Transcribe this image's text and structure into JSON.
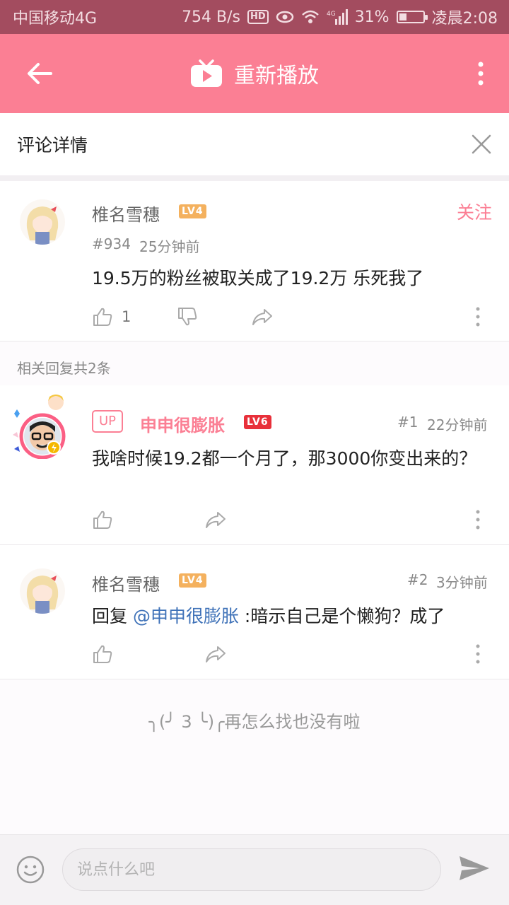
{
  "status_bar": {
    "carrier": "中国移动4G",
    "network_speed": "754 B/s",
    "hd_badge": "HD",
    "battery_percent": "31%",
    "battery_level": 0.31,
    "time": "凌晨2:08"
  },
  "toolbar": {
    "title": "重新播放"
  },
  "panel": {
    "title": "评论详情"
  },
  "main_comment": {
    "username": "椎名雪穗",
    "level": "LV4",
    "floor": "#934",
    "time": "25分钟前",
    "text": "19.5万的粉丝被取关成了19.2万 乐死我了",
    "like_count": "1",
    "follow_label": "关注"
  },
  "related_header": "相关回复共2条",
  "replies": [
    {
      "up_tag": "UP",
      "username": "申申很膨胀",
      "level": "LV6",
      "floor": "#1",
      "time": "22分钟前",
      "text": "我啥时候19.2都一个月了，那3000你变出来的？"
    },
    {
      "username": "椎名雪穗",
      "level": "LV4",
      "floor": "#2",
      "time": "3分钟前",
      "reply_prefix": "回复 ",
      "mention": "@申申很膨胀",
      "text": " :暗示自己是个懒狗？成了"
    }
  ],
  "end_message": "╮(╯ 3 ╰)╭再怎么找也没有啦",
  "input": {
    "placeholder": "说点什么吧",
    "value": ""
  },
  "colors": {
    "accent": "#fb7f94",
    "status_bar": "#a34c5f",
    "mention": "#3f72b8",
    "lv4": "#f4b15e",
    "lv6": "#e8303a"
  },
  "icons": [
    "back-arrow-icon",
    "tv-icon",
    "more-vertical-icon",
    "close-icon",
    "thumbs-up-icon",
    "thumbs-down-icon",
    "share-icon",
    "emoji-icon",
    "send-icon"
  ]
}
